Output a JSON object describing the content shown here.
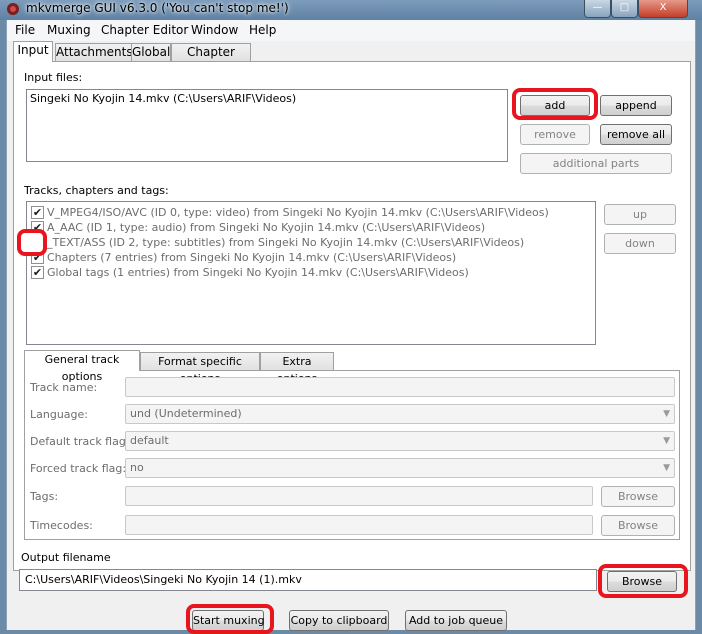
{
  "window": {
    "title": "mkvmerge GUI v6.3.0 ('You can't stop me!')",
    "controls": {
      "minimize": "—",
      "maximize": "□",
      "close": "X"
    }
  },
  "menu": [
    "File",
    "Muxing",
    "Chapter Editor",
    "Window",
    "Help"
  ],
  "tabs": [
    "Input",
    "Attachments",
    "Global",
    "Chapter Editor"
  ],
  "input": {
    "input_files_label": "Input files:",
    "files": [
      "Singeki No Kyojin 14.mkv (C:\\Users\\ARIF\\Videos)"
    ],
    "buttons": {
      "add": "add",
      "append": "append",
      "remove": "remove",
      "remove_all": "remove all",
      "additional_parts": "additional parts"
    },
    "tracks_label": "Tracks, chapters and tags:",
    "tracks": [
      {
        "label": "V_MPEG4/ISO/AVC (ID 0, type: video) from Singeki No Kyojin 14.mkv (C:\\Users\\ARIF\\Videos)",
        "checked": true
      },
      {
        "label": "A_AAC (ID 1, type: audio) from Singeki No Kyojin 14.mkv (C:\\Users\\ARIF\\Videos)",
        "checked": true
      },
      {
        "label": "_TEXT/ASS (ID 2, type: subtitles) from Singeki No Kyojin 14.mkv (C:\\Users\\ARIF\\Videos)",
        "checked": false
      },
      {
        "label": "Chapters (7 entries) from Singeki No Kyojin 14.mkv (C:\\Users\\ARIF\\Videos)",
        "checked": true
      },
      {
        "label": "Global tags (1 entries) from Singeki No Kyojin 14.mkv (C:\\Users\\ARIF\\Videos)",
        "checked": true
      }
    ],
    "track_buttons": {
      "up": "up",
      "down": "down"
    }
  },
  "subtabs": [
    "General track options",
    "Format specific options",
    "Extra options"
  ],
  "general_options": {
    "track_name_label": "Track name:",
    "track_name_value": "",
    "language_label": "Language:",
    "language_value": "und (Undetermined)",
    "default_flag_label": "Default track flag:",
    "default_flag_value": "default",
    "forced_flag_label": "Forced track flag:",
    "forced_flag_value": "no",
    "tags_label": "Tags:",
    "tags_value": "",
    "tags_browse": "Browse",
    "timecodes_label": "Timecodes:",
    "timecodes_value": "",
    "timecodes_browse": "Browse"
  },
  "output": {
    "label": "Output filename",
    "value": "C:\\Users\\ARIF\\Videos\\Singeki No Kyojin 14 (1).mkv",
    "browse": "Browse"
  },
  "bottom_buttons": {
    "start_muxing": "Start muxing",
    "copy_to_clipboard": "Copy to clipboard",
    "add_to_job_queue": "Add to job queue"
  },
  "colors": {
    "highlight": "#e8141e",
    "titlebar": "#6b8aa8"
  },
  "icons": {
    "checkmark": "✔",
    "combo_arrow": "▼"
  }
}
